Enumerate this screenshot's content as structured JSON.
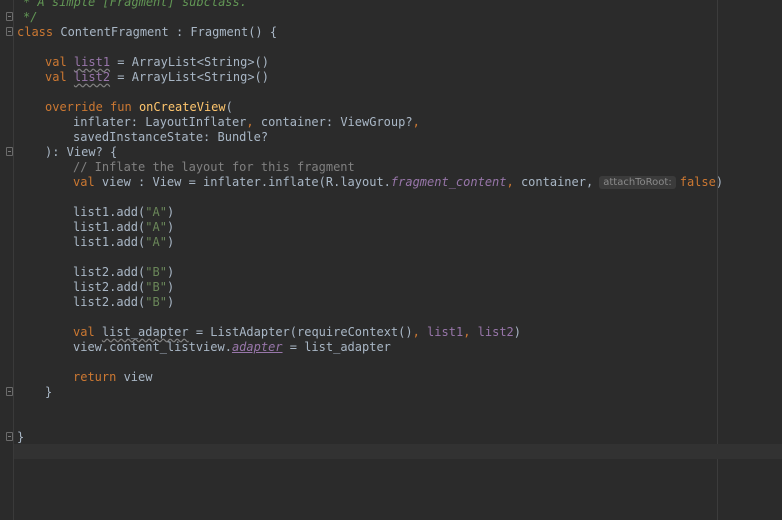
{
  "editor": {
    "lines": {
      "doc1": "* A simple [Fragment] subclass.",
      "doc2": "*/",
      "class_kw": "class",
      "class_rest": " ContentFragment : Fragment() {",
      "l1_kw": "val",
      "l1_name": "list1",
      "l1_rest": " = ArrayList<String>()",
      "l2_kw": "val",
      "l2_name": "list2",
      "l2_rest": " = ArrayList<String>()",
      "ov_kw1": "override fun",
      "ov_fn": "onCreateView",
      "ov_paren": "(",
      "p1_a": "inflater: LayoutInflater",
      "p1_comma": ",",
      "p1_b": " container: ViewGroup?",
      "p1_comma2": ",",
      "p2": "savedInstanceState: Bundle?",
      "ret_type": "): View? {",
      "comment": "// Inflate the layout for this fragment",
      "inf_kw": "val",
      "inf_a": " view : View = inflater.inflate(R.layout.",
      "inf_prop": "fragment_content",
      "inf_comma": ",",
      "inf_b": " container,",
      "inf_hint": "attachToRoot:",
      "inf_false": "false",
      "inf_close": ")",
      "add_a1": "list1.add(",
      "add_a_str": "\"A\"",
      "add_a_close": ")",
      "add_b1": "list2.add(",
      "add_b_str": "\"B\"",
      "add_b_close": ")",
      "ad_kw": "val",
      "ad_name": "list_adapter",
      "ad_a": " = ListAdapter(requireContext()",
      "ad_comma": ",",
      "ad_l1": " list1",
      "ad_comma2": ",",
      "ad_l2": " list2",
      "ad_close": ")",
      "lv_a": "view.content_listview.",
      "lv_prop": "adapter",
      "lv_b": " = list_adapter",
      "ret_kw": "return",
      "ret_rest": " view",
      "close_inner": "}",
      "close_outer": "}"
    }
  }
}
